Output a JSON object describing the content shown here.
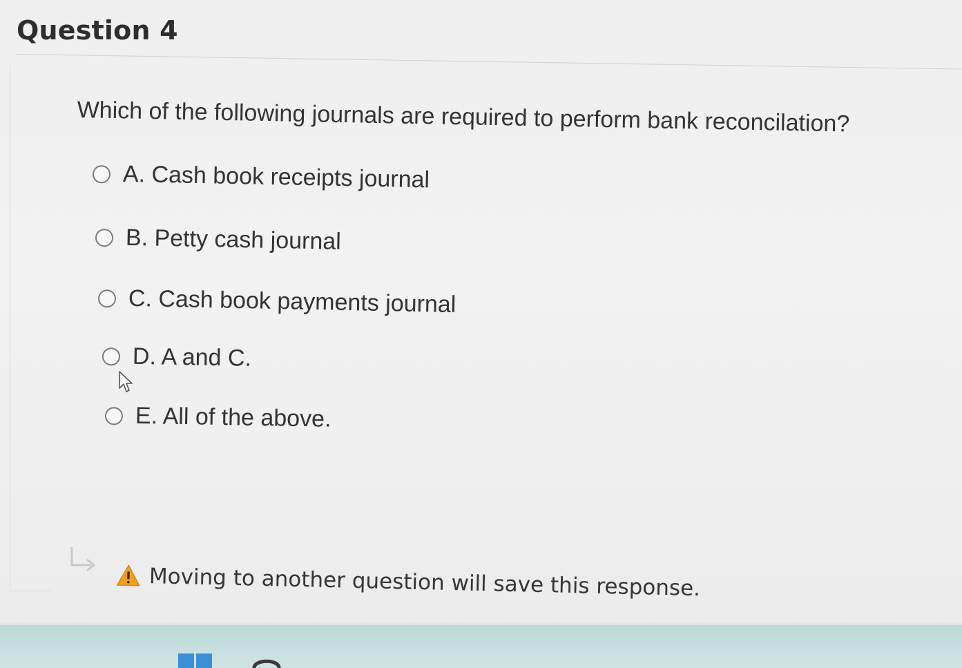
{
  "question": {
    "title": "Question 4",
    "text": "Which of the following journals are required to perform bank reconcilation?"
  },
  "options": [
    {
      "label": "A. Cash book receipts journal",
      "selected": false
    },
    {
      "label": "B. Petty cash journal",
      "selected": false
    },
    {
      "label": "C. Cash book payments journal",
      "selected": false
    },
    {
      "label": "D. A and C.",
      "selected": false
    },
    {
      "label": "E. All of the above.",
      "selected": false
    }
  ],
  "notice": {
    "icon": "warning-icon",
    "text": "Moving to another question will save this response."
  },
  "colors": {
    "warning": "#f0a020",
    "taskbar": "#c4dfde",
    "start_blue": "#3b8fd6"
  }
}
